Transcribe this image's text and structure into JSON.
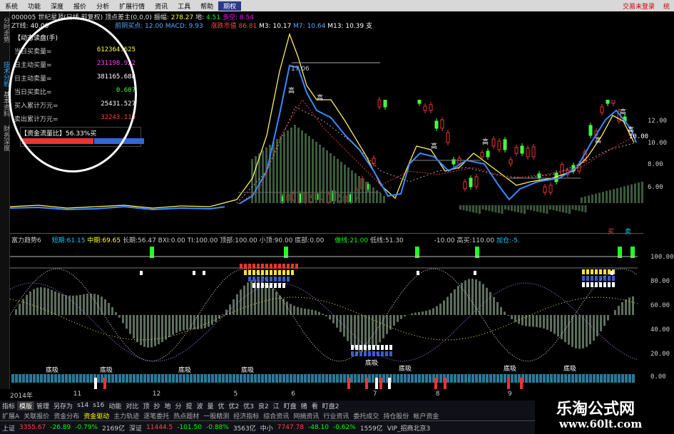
{
  "menu": {
    "items": [
      "系统",
      "功能",
      "深度",
      "报价",
      "分析",
      "扩展行情",
      "资讯",
      "工具",
      "帮助",
      "期权"
    ],
    "active_index": 9,
    "right": [
      "交易未登录",
      "统"
    ]
  },
  "side_tabs": [
    "分时走势",
    "技术分析",
    "基本资料",
    "财务深度"
  ],
  "side_tab_active": 1,
  "header": {
    "stock_code": "000005",
    "stock_name": "世纪星源(日线 前复权)",
    "indicator": "顶点差主(0,0,0)",
    "amplitude_label": "振幅:",
    "amplitude_value": "278.27",
    "up_label": "地:",
    "up_value": "4.51",
    "down_label": "多空:",
    "down_value": "8.54",
    "zt_label": "ZT线:",
    "zt_value": "40.00",
    "ma_label": "前阴买点:",
    "ma_value": "12.00",
    "macd_label": "MACD:",
    "macd_value": "9.93",
    "ma5_label": "涨跌市值",
    "ma5_value": "86.81",
    "ma3_label": "M3:",
    "ma3_value": "10.17",
    "ma7_label": "M7:",
    "ma7_value": "10.64",
    "ma13_label": "M13:",
    "ma13_value": "10.39",
    "support_label": "支"
  },
  "dynamic_panel": {
    "title": "【动态读盘(手)",
    "rows": [
      {
        "label": "当日买卖量=",
        "value": "612364.625",
        "color": "#ffff40"
      },
      {
        "label": "日主动买量=",
        "value": "231198.922",
        "color": "#ff40ff"
      },
      {
        "label": "日主动卖量=",
        "value": "381165.688",
        "color": "#ffffff"
      },
      {
        "label": "当日买卖比=",
        "value": "0.607",
        "color": "#40ff40"
      },
      {
        "label": "买入累计万元=",
        "value": "25431.527",
        "color": "#ffffff"
      },
      {
        "label": "卖出累计万元=",
        "value": "32243.115",
        "color": "#ff4040"
      }
    ],
    "ratio_label": "【资金流量比】56.33%买"
  },
  "price_axis": [
    "12.00",
    "10.00",
    "8.00",
    "6.00"
  ],
  "price_axis_cut": "10.00",
  "price_peak_label": "17.06",
  "high_label": "高",
  "low_label": "底吸",
  "buy_label": "买",
  "sell_label": "卖",
  "indicator_line": {
    "name": "富力趋势6",
    "short_label": "短期:",
    "short_value": "61.15",
    "mid_label": "中期:",
    "mid_value": "69.65",
    "long_label": "长期:",
    "long_value": "56.47",
    "bxi_label": "BXI:",
    "bxi_value": "0.00",
    "ti_label": "TI:",
    "ti_value": "100.00",
    "top_label": "顶部:",
    "top_value": "100.00",
    "small_top_label": "小顶:",
    "small_top_value": "90.00",
    "bottom_label": "底部:",
    "bottom_value": "0.00",
    "hi_line_label": "做线:",
    "hi_line_value": "21.00",
    "lo_line_label": "低线:",
    "lo_line_value": "51.30",
    "neg_value": "-10.00",
    "high_buy_label": "高买:",
    "high_buy_value": "110.00",
    "extra_label": "加仓:",
    "extra_value": "-5."
  },
  "ind_axis": [
    "100.00",
    "80.00",
    "60.00",
    "40.00",
    "20.00",
    "0.00"
  ],
  "x_ticks": [
    {
      "label": "2014年",
      "pos": 0
    },
    {
      "label": "11",
      "pos": 0.1
    },
    {
      "label": "12",
      "pos": 0.225
    },
    {
      "label": "5",
      "pos": 0.353
    },
    {
      "label": "6",
      "pos": 0.444
    },
    {
      "label": "7",
      "pos": 0.573
    },
    {
      "label": "8",
      "pos": 0.672
    },
    {
      "label": "9",
      "pos": 0.786
    }
  ],
  "bottom_tabs1": [
    "指标",
    "模版",
    "管理",
    "另存为",
    "s14",
    "s16",
    "动能",
    "对比",
    "顶",
    "抄",
    "地",
    "分",
    "提",
    "波",
    "量",
    "优",
    "优2",
    "优3",
    "良2",
    "江",
    "盯盘",
    "赌",
    "看",
    "盯盘2"
  ],
  "bottom_tabs1_selected": 1,
  "bottom_tabs2": [
    "扩展A",
    "关联报价",
    "资金分布",
    "资金驱动",
    "主力轨迹",
    "逐笔委托",
    "热点题材",
    "一股精测",
    "经济指标",
    "综合资讯",
    "网摘资讯",
    "行业资讯",
    "委托成交",
    "持仓股份",
    "帐户资金"
  ],
  "status": [
    {
      "t": "上证",
      "c": "#ccc"
    },
    {
      "t": "3355.67",
      "c": "#f44"
    },
    {
      "t": "-26.89",
      "c": "#0f0"
    },
    {
      "t": "-0.79%",
      "c": "#0f0"
    },
    {
      "t": "2169亿",
      "c": "#ccc"
    },
    {
      "t": "深证",
      "c": "#ccc"
    },
    {
      "t": "11444.5",
      "c": "#f44"
    },
    {
      "t": "-101.50",
      "c": "#0f0"
    },
    {
      "t": "-0.88%",
      "c": "#0f0"
    },
    {
      "t": "3563亿",
      "c": "#ccc"
    },
    {
      "t": "中小",
      "c": "#ccc"
    },
    {
      "t": "7747.78",
      "c": "#f44"
    },
    {
      "t": "-48.10",
      "c": "#0f0"
    },
    {
      "t": "-0.62%",
      "c": "#0f0"
    },
    {
      "t": "1559亿",
      "c": "#ccc"
    },
    {
      "t": "VIP_招商北京3",
      "c": "#ccc"
    }
  ],
  "logo": {
    "title": "乐淘公式网",
    "url": "www.60lt.com"
  }
}
